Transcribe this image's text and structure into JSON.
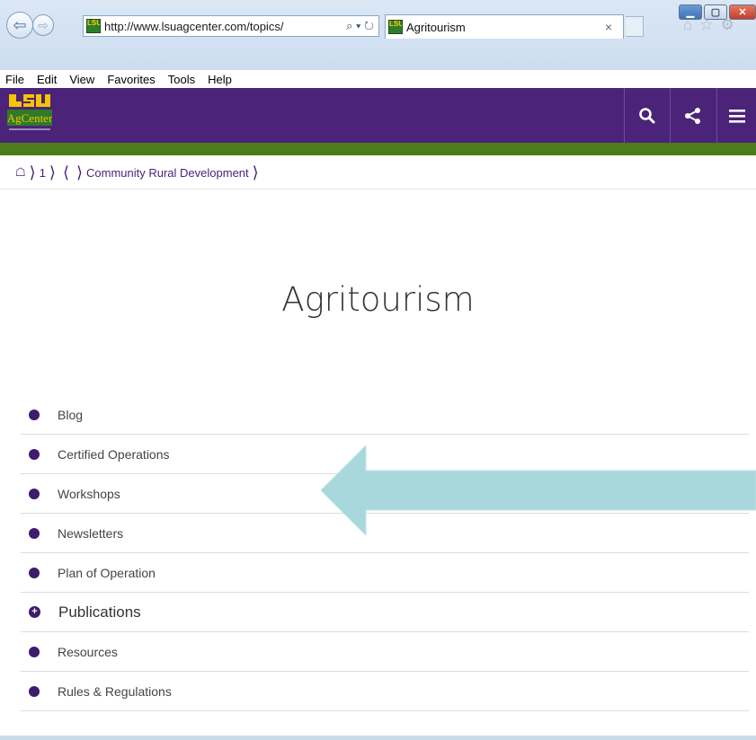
{
  "browser": {
    "url": "http://www.lsuagcenter.com/topics/",
    "tab_title": "Agritourism",
    "address_tools": "⌕ ▾ ↻",
    "tab_close": "×",
    "menu": [
      "File",
      "Edit",
      "View",
      "Favorites",
      "Tools",
      "Help"
    ]
  },
  "breadcrumb": {
    "home_icon": "☖",
    "items": [
      "1",
      "",
      "Community Rural Development"
    ]
  },
  "page": {
    "title": "Agritourism"
  },
  "topics": [
    {
      "label": "Blog",
      "icon": "dot"
    },
    {
      "label": "Certified Operations",
      "icon": "dot"
    },
    {
      "label": "Workshops",
      "icon": "dot"
    },
    {
      "label": "Newsletters",
      "icon": "dot"
    },
    {
      "label": "Plan of Operation",
      "icon": "dot"
    },
    {
      "label": "Publications",
      "icon": "plus"
    },
    {
      "label": "Resources",
      "icon": "dot"
    },
    {
      "label": "Rules & Regulations",
      "icon": "dot"
    }
  ],
  "colors": {
    "brand_purple": "#4b2379",
    "brand_green": "#4b7d1b",
    "arrow": "#a8d8dc"
  }
}
